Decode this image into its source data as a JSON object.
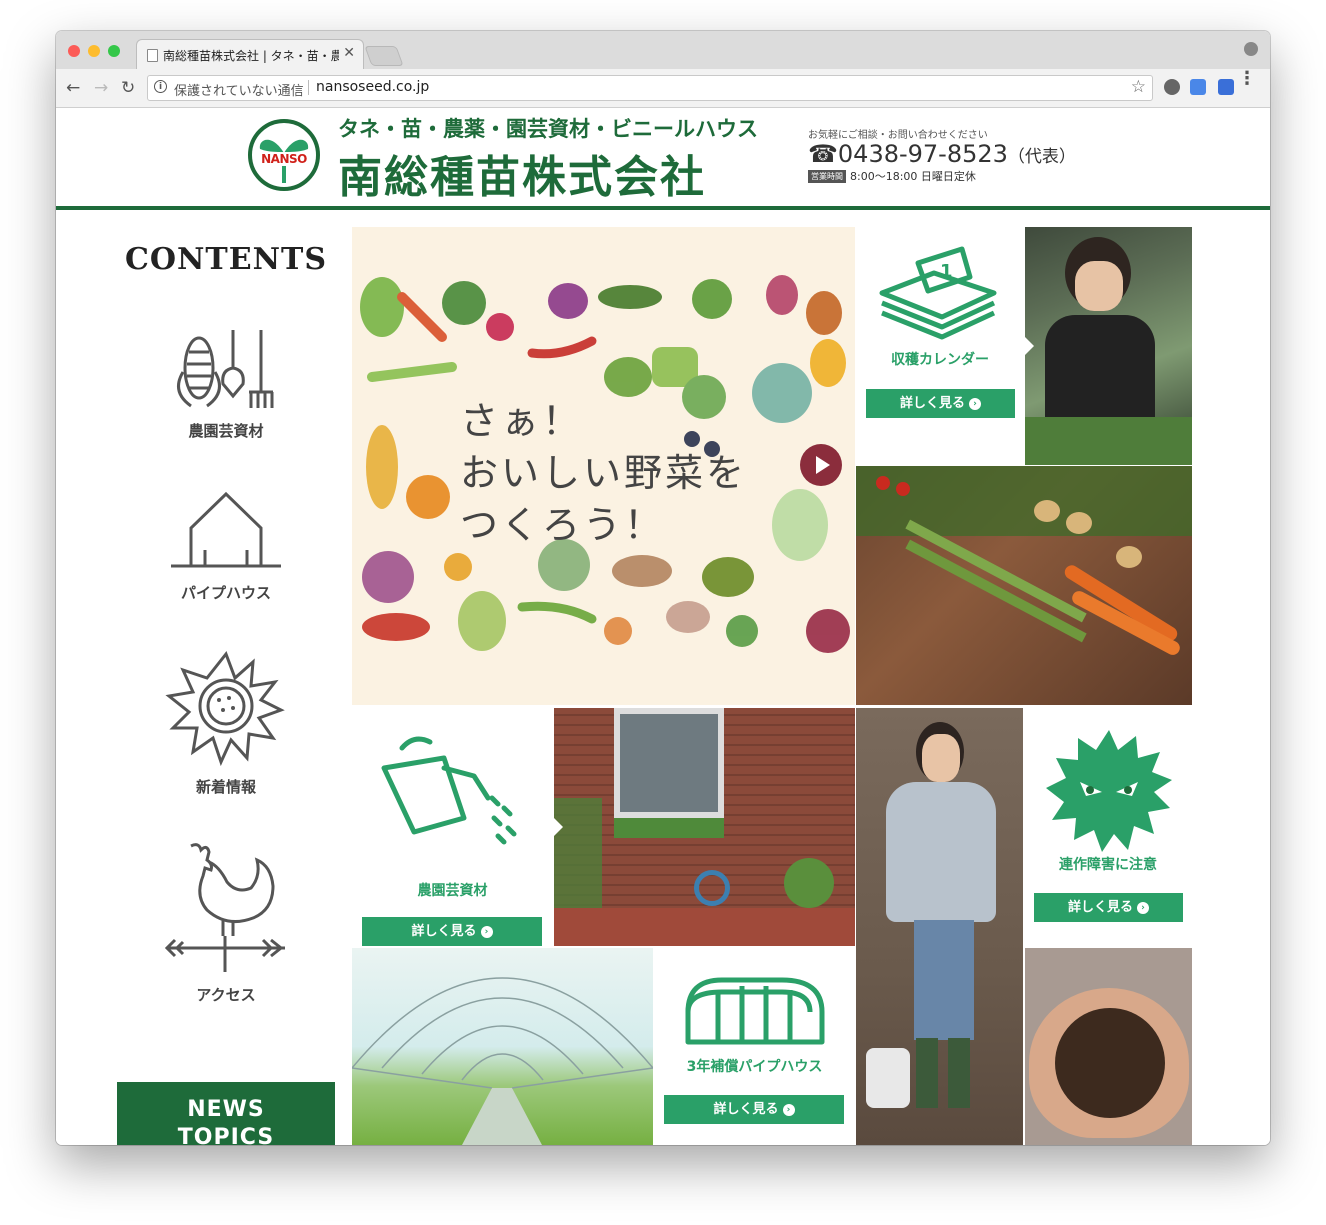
{
  "browser": {
    "tab_title": "南総種苗株式会社 | タネ・苗・農薬",
    "tab_close": "✕",
    "omnibox_security": "保護されていない通信",
    "url": "nansoseed.co.jp",
    "back": "←",
    "forward": "→",
    "reload": "↻",
    "info": "i",
    "bookmark": "☆",
    "menu": "⋮",
    "icons": [
      "back-icon",
      "forward-icon",
      "reload-icon",
      "info-icon",
      "star-icon",
      "wordpress-icon",
      "translate-icon",
      "extension-icon",
      "menu-icon"
    ]
  },
  "header": {
    "logo_text": "NANSO",
    "tagline": "タネ・苗・農薬・園芸資材・ビニールハウス",
    "company": "南総種苗株式会社",
    "consult": "お気軽にご相談・お問い合わせください",
    "phone_icon": "☎",
    "phone": "0438-97-8523",
    "phone_suffix": "（代表）",
    "hours_badge": "営業時間",
    "hours": "8:00～18:00 日曜日定休"
  },
  "sidebar": {
    "title": "CONTENTS",
    "items": [
      {
        "label": "農園芸資材",
        "icon": "corn-tools-icon"
      },
      {
        "label": "パイプハウス",
        "icon": "house-icon"
      },
      {
        "label": "新着情報",
        "icon": "sunflower-icon"
      },
      {
        "label": "アクセス",
        "icon": "rooster-weathervane-icon"
      }
    ],
    "news_label_1": "NEWS",
    "news_label_2": "TOPICS"
  },
  "hero": {
    "line1": "さぁ！",
    "line2": "おいしい野菜を",
    "line3": "つくろう！"
  },
  "tiles": {
    "calendar_label": "収穫カレンダー",
    "calendar_btn": "詳しく見る",
    "materials_label": "農園芸資材",
    "materials_btn": "詳しく見る",
    "pipehouse_label": "3年補償パイプハウス",
    "pipehouse_btn": "詳しく見る",
    "rotation_label": "連作障害に注意",
    "rotation_btn": "詳しく見る",
    "arrow": "›"
  },
  "colors": {
    "brand_green": "#1e6b3a",
    "accent_green": "#2aa068",
    "red": "#d0211a",
    "play": "#8b2d3c"
  }
}
